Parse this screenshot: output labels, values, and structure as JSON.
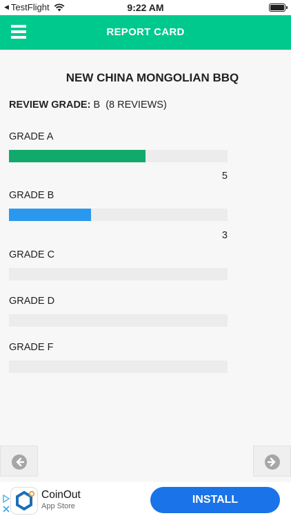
{
  "status_bar": {
    "back_label": "TestFlight",
    "time": "9:22 AM"
  },
  "header": {
    "title": "REPORT CARD",
    "menu_icon": "hamburger-menu-icon"
  },
  "restaurant": {
    "name": "NEW CHINA MONGOLIAN BBQ"
  },
  "review": {
    "label": "REVIEW GRADE:",
    "grade": "B",
    "count_text": "(8 REVIEWS)"
  },
  "grades": [
    {
      "label": "GRADE A",
      "count": "5",
      "fraction": 0.625,
      "color": "#12a96c"
    },
    {
      "label": "GRADE B",
      "count": "3",
      "fraction": 0.375,
      "color": "#2b98f0"
    },
    {
      "label": "GRADE C",
      "count": "",
      "fraction": 0,
      "color": "#ececec"
    },
    {
      "label": "GRADE D",
      "count": "",
      "fraction": 0,
      "color": "#ececec"
    },
    {
      "label": "GRADE F",
      "count": "",
      "fraction": 0,
      "color": "#ececec"
    }
  ],
  "nav": {
    "prev_icon": "arrow-left-icon",
    "next_icon": "arrow-right-icon"
  },
  "ad": {
    "name": "CoinOut",
    "subtitle": "App Store",
    "cta": "INSTALL"
  },
  "colors": {
    "accent": "#00c98d",
    "install": "#1a73e8"
  }
}
